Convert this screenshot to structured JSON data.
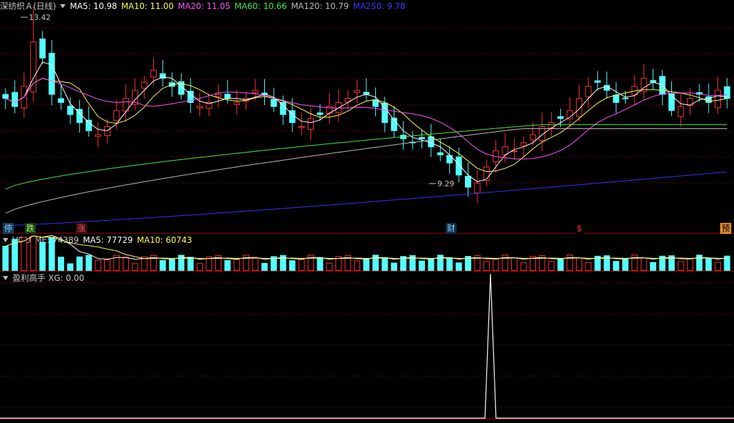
{
  "main_legend": {
    "name": "深纺织Ａ(日线)",
    "ma5": "MA5: 10.98",
    "ma10": "MA10: 11.00",
    "ma20": "MA20: 11.05",
    "ma60": "MA60: 10.66",
    "ma120": "MA120: 10.79",
    "ma250": "MA250: 9.78"
  },
  "vol_legend": {
    "vol": "VOLUME: 74389",
    "ma5": "MA5: 77729",
    "ma10": "MA10: 60743"
  },
  "ind_legend": {
    "name": "盈利高手",
    "xg": "XG: 0.00"
  },
  "markers": [
    {
      "label": "停",
      "color": "#7fd0ff",
      "bg": "#1a3a5a"
    },
    {
      "label": "跌",
      "color": "#a0ff60",
      "bg": "#1a3a1a"
    },
    {
      "label": "涨",
      "color": "#ff5050",
      "bg": "#3a1010"
    },
    {
      "label": "财",
      "color": "#7fd0ff",
      "bg": "#102a4a"
    },
    {
      "label": "$",
      "color": "#ff3030",
      "bg": "#000000"
    },
    {
      "label": "预",
      "color": "#000000",
      "bg": "#e08a30"
    }
  ],
  "colors": {
    "up": "#ff3333",
    "down": "#54ffff",
    "grid": "#7a0000",
    "ma5": "#ffffff",
    "ma10": "#ffff55",
    "ma20": "#ff55ff",
    "ma60": "#44ee44",
    "ma120": "#bbbbbb",
    "ma250": "#3333ff"
  },
  "chart_data": {
    "type": "candlestick",
    "price_labels": {
      "high": "13.42",
      "low": "9.29"
    },
    "ohlc_close_series": [
      11.6,
      11.4,
      11.9,
      13.0,
      12.6,
      11.7,
      11.5,
      11.2,
      11.0,
      10.8,
      10.7,
      10.9,
      11.3,
      11.6,
      11.8,
      12.0,
      12.3,
      12.1,
      11.9,
      11.7,
      11.5,
      11.4,
      11.5,
      11.7,
      11.6,
      11.5,
      11.6,
      11.8,
      11.7,
      11.4,
      11.2,
      11.0,
      10.9,
      11.1,
      11.2,
      11.4,
      11.5,
      11.6,
      11.8,
      11.7,
      11.4,
      11.0,
      10.8,
      10.6,
      10.5,
      10.6,
      10.4,
      10.2,
      10.0,
      9.7,
      9.4,
      9.5,
      9.9,
      10.3,
      10.4,
      10.3,
      10.5,
      10.7,
      10.9,
      11.0,
      11.1,
      11.3,
      11.6,
      11.9,
      12.0,
      11.8,
      11.5,
      11.6,
      11.9,
      12.1,
      12.0,
      11.7,
      11.3,
      11.4,
      11.6,
      11.7,
      11.5,
      11.8,
      11.6
    ],
    "volume": {
      "current": 74389,
      "ma5": 77729,
      "ma10": 60743
    },
    "indicator": {
      "name": "盈利高手",
      "xg": 0.0
    }
  }
}
